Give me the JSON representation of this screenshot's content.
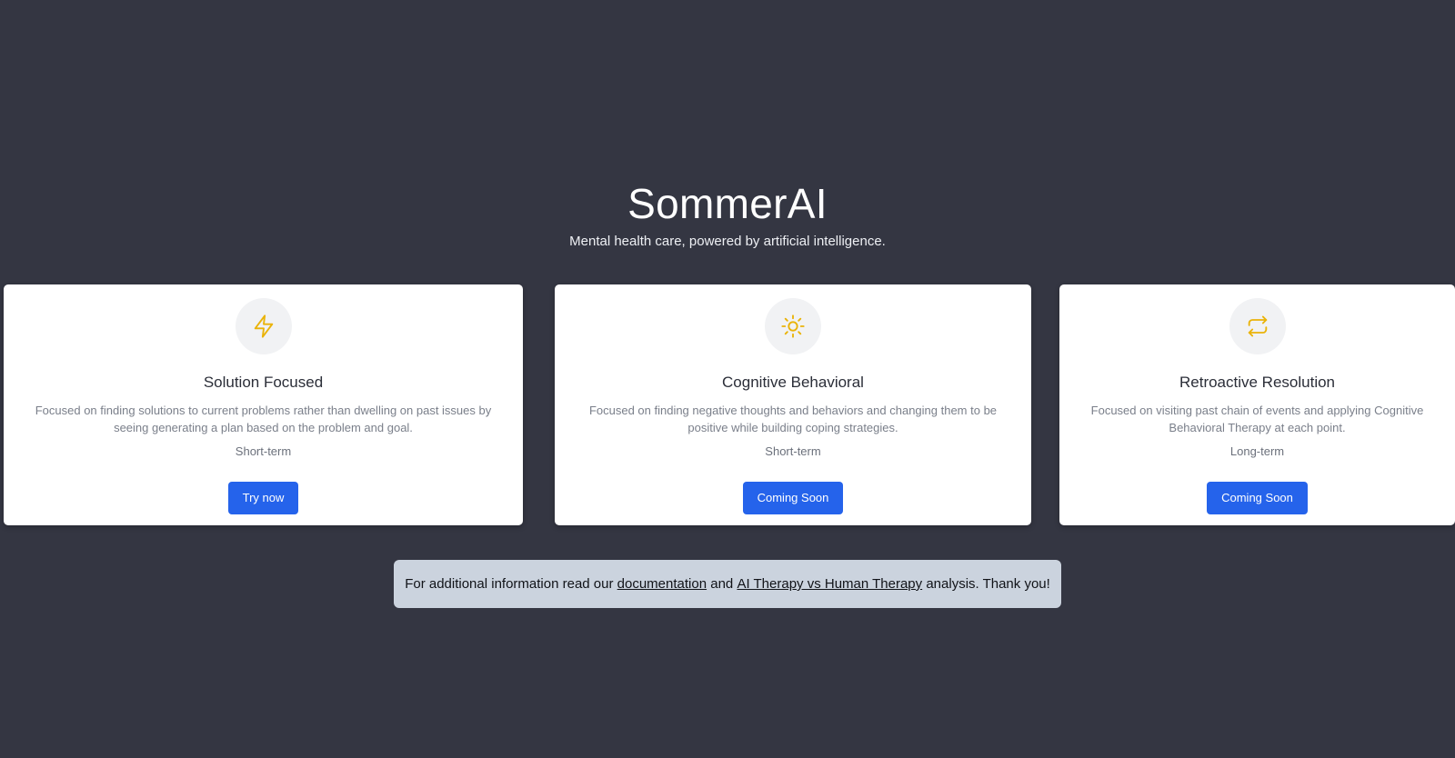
{
  "hero": {
    "title": "SommerAI",
    "subtitle": "Mental health care, powered by artificial intelligence."
  },
  "cards": [
    {
      "icon": "lightning-icon",
      "title": "Solution Focused",
      "description": "Focused on finding solutions to current problems rather than dwelling on past issues by seeing generating a plan based on the problem and goal.",
      "term": "Short-term",
      "button_label": "Try now"
    },
    {
      "icon": "sun-icon",
      "title": "Cognitive Behavioral",
      "description": "Focused on finding negative thoughts and behaviors and changing them to be positive while building coping strategies.",
      "term": "Short-term",
      "button_label": "Coming Soon"
    },
    {
      "icon": "refresh-icon",
      "title": "Retroactive Resolution",
      "description": "Focused on visiting past chain of events and applying Cognitive Behavioral Therapy at each point.",
      "term": "Long-term",
      "button_label": "Coming Soon"
    }
  ],
  "info": {
    "prefix": "For additional information read our",
    "link_documentation": "documentation",
    "connector": "and",
    "link_analysis": "AI Therapy vs Human Therapy",
    "suffix": "analysis. Thank you!"
  },
  "colors": {
    "background": "#343642",
    "accent": "#2563eb",
    "icon": "#eab308",
    "info_bar": "#cbd3de"
  }
}
